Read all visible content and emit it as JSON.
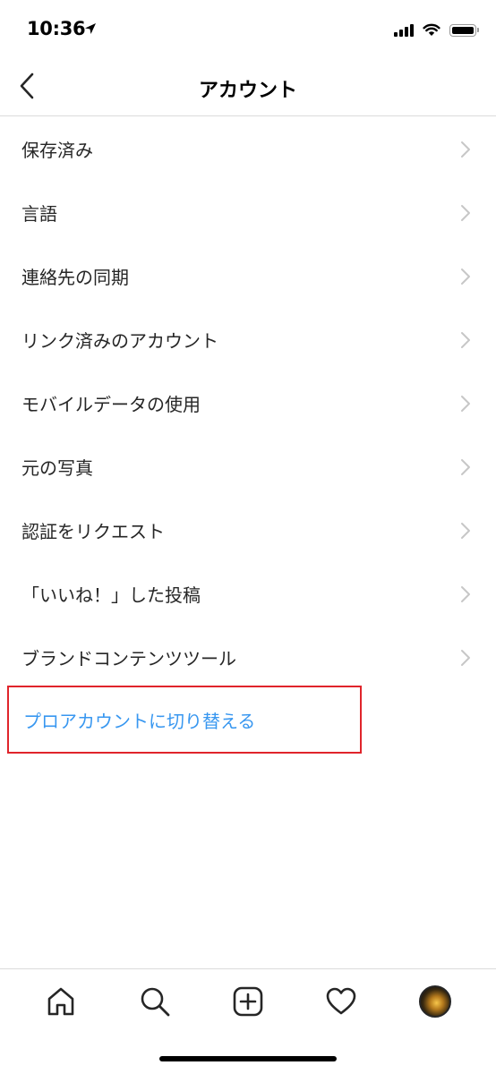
{
  "status_bar": {
    "time": "10:36"
  },
  "header": {
    "title": "アカウント"
  },
  "menu": {
    "items": [
      {
        "label": "保存済み"
      },
      {
        "label": "言語"
      },
      {
        "label": "連絡先の同期"
      },
      {
        "label": "リンク済みのアカウント"
      },
      {
        "label": "モバイルデータの使用"
      },
      {
        "label": "元の写真"
      },
      {
        "label": "認証をリクエスト"
      },
      {
        "label": "「いいね！」した投稿"
      },
      {
        "label": "ブランドコンテンツツール"
      }
    ],
    "pro_account": {
      "label": "プロアカウントに切り替える"
    }
  },
  "tab_bar": {
    "items": [
      "home-icon",
      "search-icon",
      "new-post-icon",
      "activity-heart-icon",
      "profile-avatar"
    ]
  },
  "colors": {
    "link_blue": "#3897f0",
    "highlight_red": "#e0242b",
    "text": "#262626",
    "divider": "#dbdbdb"
  }
}
